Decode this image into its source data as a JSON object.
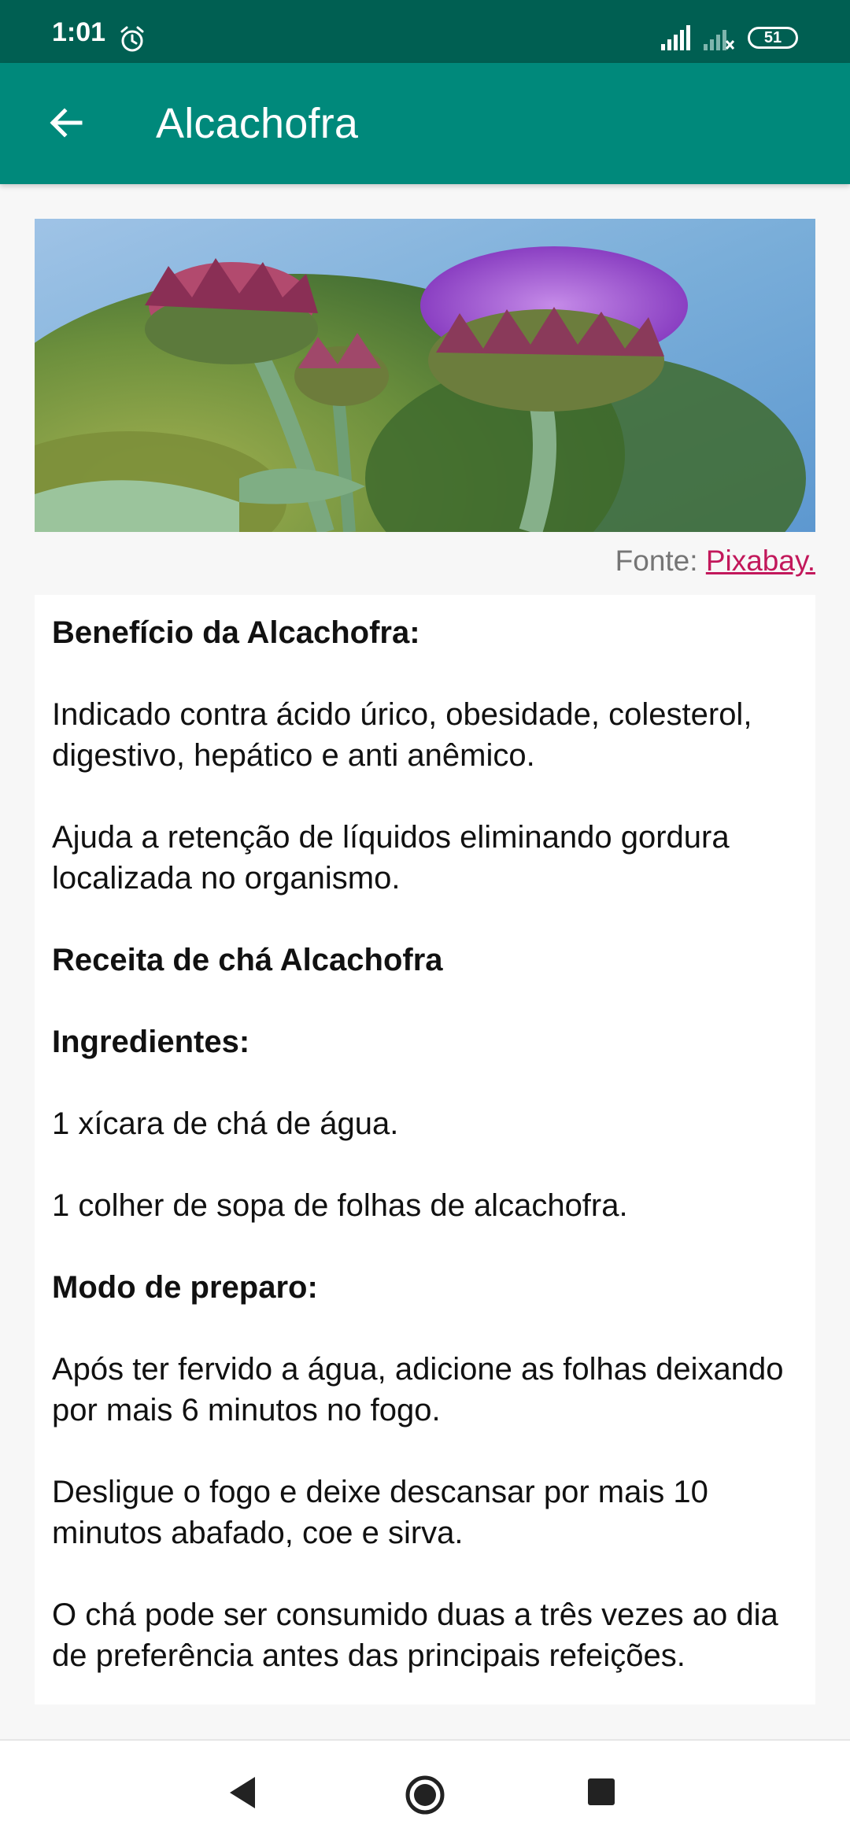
{
  "status_bar": {
    "time": "1:01",
    "battery": "51",
    "icons": [
      "alarm-icon",
      "signal-icon",
      "signal-off-icon",
      "battery-icon"
    ]
  },
  "app_bar": {
    "title": "Alcachofra",
    "back_icon": "arrow-back-icon"
  },
  "image": {
    "subject": "artichoke-flower-photo",
    "caption_prefix": "Fonte:",
    "caption_link": "Pixabay."
  },
  "content": {
    "benefit_heading": "Benefício da Alcachofra:",
    "benefit_p1": "Indicado contra ácido úrico, obesidade, colesterol, digestivo, hepático e anti anêmico.",
    "benefit_p2": "Ajuda a retenção de líquidos eliminando gordura localizada no organismo.",
    "recipe_heading": "Receita de chá Alcachofra",
    "ingredients_heading": "Ingredientes:",
    "ingredient_1": "1 xícara de chá de água.",
    "ingredient_2": "1 colher de sopa de folhas de alcachofra.",
    "method_heading": "Modo de preparo:",
    "method_p1": "Após ter fervido a água, adicione as folhas deixando por mais 6 minutos no fogo.",
    "method_p2": "Desligue o fogo e deixe descansar por mais 10 minutos abafado, coe e sirva.",
    "method_p3": "O chá pode ser consumido duas a três vezes ao dia de preferência antes das principais refeições."
  },
  "colors": {
    "status_bar": "#005f52",
    "app_bar": "#00897b",
    "link": "#c2185b"
  }
}
